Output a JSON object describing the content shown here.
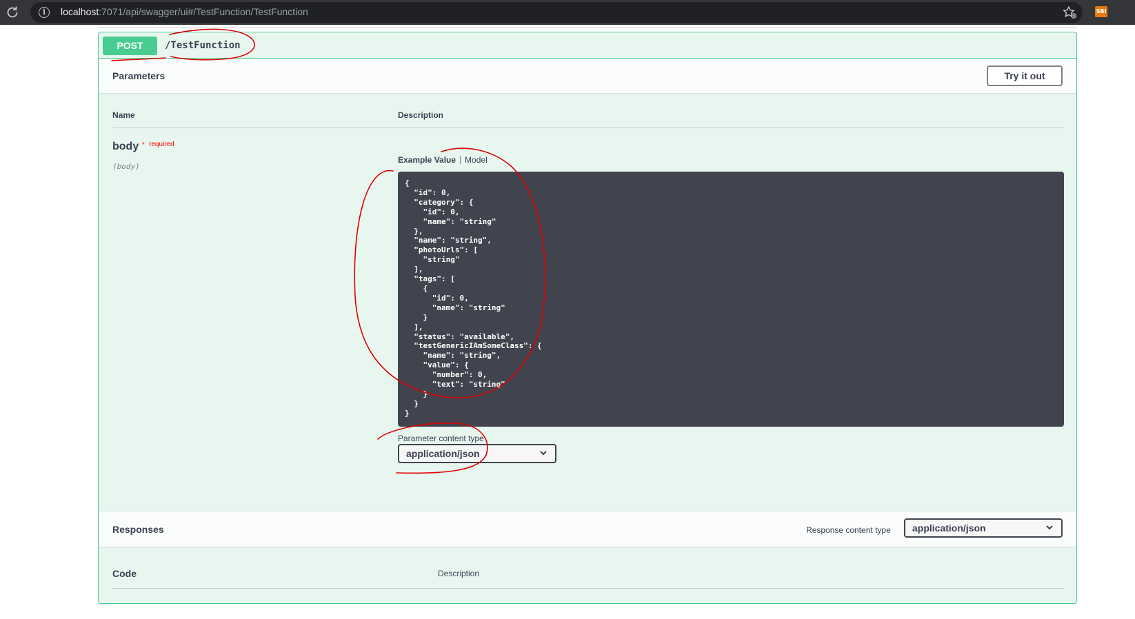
{
  "browser": {
    "url_host": "localhost",
    "url_rest": ":7071/api/swagger/ui#/TestFunction/TestFunction",
    "ext_badge": "SBI"
  },
  "operation": {
    "method": "POST",
    "path": "/TestFunction"
  },
  "parameters": {
    "title": "Parameters",
    "try_button": "Try it out",
    "col_name": "Name",
    "col_description": "Description",
    "param_name": "body",
    "required_star": "*",
    "required_label": "required",
    "param_in": "(body)",
    "tab_example": "Example Value",
    "tab_model": "Model",
    "example_json": "{\n  \"id\": 0,\n  \"category\": {\n    \"id\": 0,\n    \"name\": \"string\"\n  },\n  \"name\": \"string\",\n  \"photoUrls\": [\n    \"string\"\n  ],\n  \"tags\": [\n    {\n      \"id\": 0,\n      \"name\": \"string\"\n    }\n  ],\n  \"status\": \"available\",\n  \"testGenericIAmSomeClass\": {\n    \"name\": \"string\",\n    \"value\": {\n      \"number\": 0,\n      \"text\": \"string\"\n    }\n  }\n}",
    "content_type_label": "Parameter content type",
    "content_type_value": "application/json"
  },
  "responses": {
    "title": "Responses",
    "content_type_label": "Response content type",
    "content_type_value": "application/json",
    "col_code": "Code",
    "col_description": "Description"
  },
  "colors": {
    "post_green": "#49cc90",
    "block_bg": "#e8f6f0",
    "code_bg": "#41444e",
    "annotation_red": "#e00000"
  }
}
